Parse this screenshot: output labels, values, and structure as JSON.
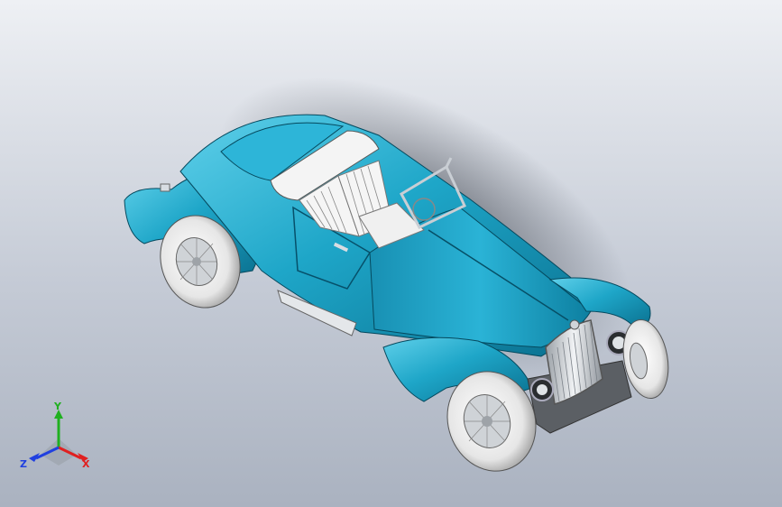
{
  "viewport": {
    "background_top": "#eef0f4",
    "background_bottom": "#aab2c0"
  },
  "model": {
    "body_color": "#1ea6c8",
    "chrome_color": "#d8dde2",
    "tire_color": "#f0f0f0"
  },
  "triad": {
    "x_label": "X",
    "y_label": "Y",
    "z_label": "Z",
    "x_color": "#e02020",
    "y_color": "#20b020",
    "z_color": "#2040e0"
  }
}
